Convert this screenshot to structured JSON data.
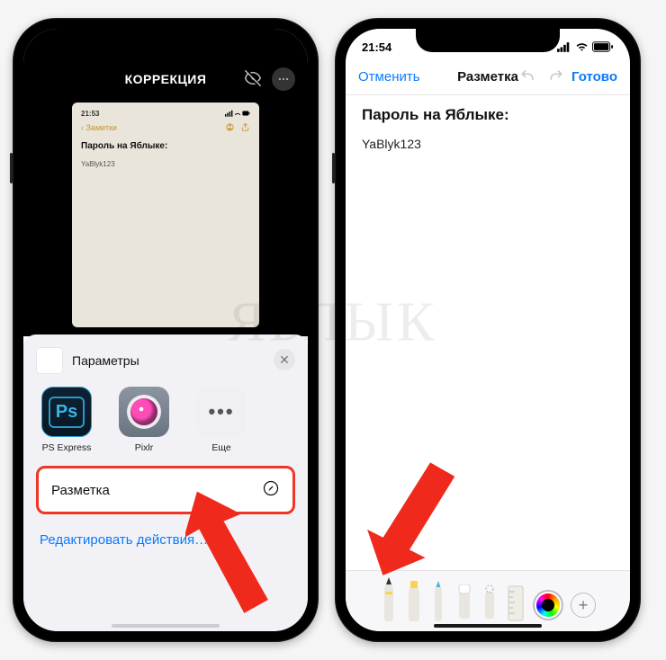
{
  "watermark": "ЯБЛЫК",
  "phone1": {
    "status_time": "",
    "header_title": "КОРРЕКЦИЯ",
    "thumbnail": {
      "time": "21:53",
      "back": "Заметки",
      "title": "Пароль на Яблыке:",
      "body": "YaBlyk123"
    },
    "sheet": {
      "title": "Параметры",
      "apps": [
        {
          "label": "PS Express"
        },
        {
          "label": "Pixlr"
        },
        {
          "label": "Еще"
        }
      ],
      "action_label": "Разметка",
      "edit_label": "Редактировать действия…"
    }
  },
  "phone2": {
    "status_time": "21:54",
    "header": {
      "cancel": "Отменить",
      "title": "Разметка",
      "done": "Готово"
    },
    "doc": {
      "title": "Пароль на Яблыке:",
      "body": "YaBlyk123"
    }
  }
}
